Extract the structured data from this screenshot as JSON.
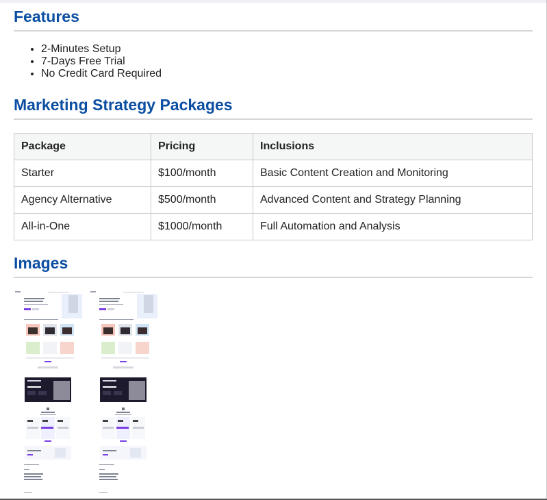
{
  "features": {
    "title": "Features",
    "items": [
      "2-Minutes Setup",
      "7-Days Free Trial",
      "No Credit Card Required"
    ]
  },
  "packages": {
    "title": "Marketing Strategy Packages",
    "headers": [
      "Package",
      "Pricing",
      "Inclusions"
    ],
    "rows": [
      [
        "Starter",
        "$100/month",
        "Basic Content Creation and Monitoring"
      ],
      [
        "Agency Alternative",
        "$500/month",
        "Advanced Content and Strategy Planning"
      ],
      [
        "All-in-One",
        "$1000/month",
        "Full Automation and Analysis"
      ]
    ]
  },
  "images": {
    "title": "Images"
  },
  "colors": {
    "heading": "#0b4ea2",
    "accent_purple": "#7b3fe4",
    "dark_panel": "#1e1a2e"
  }
}
